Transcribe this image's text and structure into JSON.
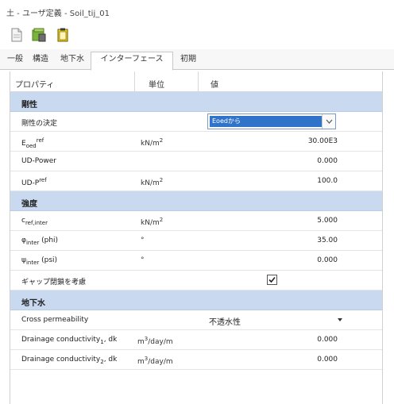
{
  "window": {
    "title": "土 - ユーザ定義 - Soil_tij_01"
  },
  "toolbar": {
    "icons": [
      "new-file-icon",
      "open-material-icon",
      "clipboard-icon"
    ]
  },
  "tabs": [
    {
      "label": "一般",
      "active": false
    },
    {
      "label": "構造",
      "active": false
    },
    {
      "label": "地下水",
      "active": false
    },
    {
      "label": "インターフェース",
      "active": true
    },
    {
      "label": "初期",
      "active": false
    }
  ],
  "table": {
    "headers": {
      "property": "プロパティ",
      "unit": "単位",
      "value": "値"
    },
    "groups": {
      "stiffness": {
        "title": "剛性",
        "rows": {
          "decision": {
            "name": "剛性の決定",
            "value": "Eoedから"
          },
          "eoed": {
            "name_main": "E",
            "name_sub": "oed",
            "name_sup": "ref",
            "unit_main": "kN/m",
            "unit_sup": "2",
            "value": "30.00E3"
          },
          "udpower": {
            "name": "UD-Power",
            "unit": "",
            "value": "0.000"
          },
          "udpref": {
            "name_main": "UD-P",
            "name_sup": "ref",
            "unit_main": "kN/m",
            "unit_sup": "2",
            "value": "100.0"
          }
        }
      },
      "strength": {
        "title": "強度",
        "rows": {
          "cref": {
            "name_main": "c",
            "name_sub": "ref,inter",
            "unit_main": "kN/m",
            "unit_sup": "2",
            "value": "5.000"
          },
          "phi": {
            "name_main": "φ",
            "name_sub": "inter",
            "name_tail": " (phi)",
            "unit": "°",
            "value": "35.00"
          },
          "psi": {
            "name_main": "ψ",
            "name_sub": "inter",
            "name_tail": " (psi)",
            "unit": "°",
            "value": "0.000"
          },
          "gap": {
            "name": "ギャップ閉鎖を考慮",
            "checked": true
          }
        }
      },
      "groundwater": {
        "title": "地下水",
        "rows": {
          "crossperm": {
            "name": "Cross permeability",
            "value": "不透水性"
          },
          "dc1": {
            "name_main": "Drainage conductivity",
            "name_sub": "1",
            "name_tail": ", dk",
            "unit_main": "m",
            "unit_sup": "3",
            "unit_tail": "/day/m",
            "value": "0.000"
          },
          "dc2": {
            "name_main": "Drainage conductivity",
            "name_sub": "2",
            "name_tail": ", dk",
            "unit_main": "m",
            "unit_sup": "3",
            "unit_tail": "/day/m",
            "value": "0.000"
          }
        }
      }
    }
  },
  "colors": {
    "group_header": "#c9daf0",
    "dropdown_selection": "#2f74c8"
  }
}
